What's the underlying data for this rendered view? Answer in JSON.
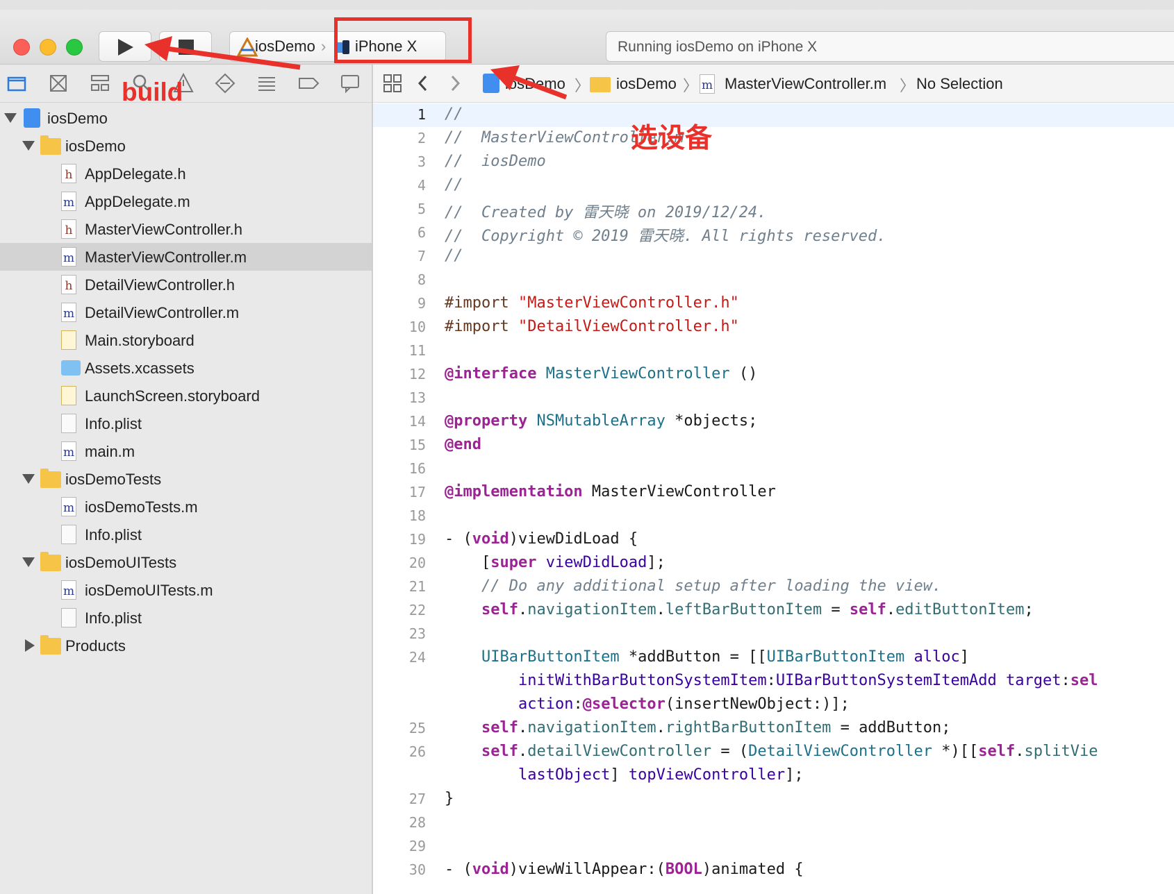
{
  "toolbar": {
    "run_button": "run",
    "stop_button": "stop",
    "scheme": {
      "target": "iosDemo",
      "device": "iPhone X"
    },
    "status_text": "Running iosDemo on iPhone X"
  },
  "annotations": {
    "build": "build",
    "select_device": "选设备",
    "accent_color": "#e8312a"
  },
  "navigator": {
    "tabs": [
      "folder-icon",
      "source-control-icon",
      "hierarchy-icon",
      "search-icon",
      "warning-icon",
      "test-icon",
      "debug-icon",
      "breakpoint-icon",
      "report-icon"
    ],
    "tree": [
      {
        "label": "iosDemo",
        "kind": "project",
        "depth": 0,
        "disclosure": "open"
      },
      {
        "label": "iosDemo",
        "kind": "folder",
        "depth": 1,
        "disclosure": "open"
      },
      {
        "label": "AppDelegate.h",
        "kind": "h",
        "depth": 2
      },
      {
        "label": "AppDelegate.m",
        "kind": "m",
        "depth": 2
      },
      {
        "label": "MasterViewController.h",
        "kind": "h",
        "depth": 2
      },
      {
        "label": "MasterViewController.m",
        "kind": "m",
        "depth": 2,
        "selected": true
      },
      {
        "label": "DetailViewController.h",
        "kind": "h",
        "depth": 2
      },
      {
        "label": "DetailViewController.m",
        "kind": "m",
        "depth": 2
      },
      {
        "label": "Main.storyboard",
        "kind": "storyboard",
        "depth": 2
      },
      {
        "label": "Assets.xcassets",
        "kind": "assets",
        "depth": 2
      },
      {
        "label": "LaunchScreen.storyboard",
        "kind": "storyboard",
        "depth": 2
      },
      {
        "label": "Info.plist",
        "kind": "plist",
        "depth": 2
      },
      {
        "label": "main.m",
        "kind": "m",
        "depth": 2
      },
      {
        "label": "iosDemoTests",
        "kind": "folder",
        "depth": 1,
        "disclosure": "open"
      },
      {
        "label": "iosDemoTests.m",
        "kind": "m",
        "depth": 2
      },
      {
        "label": "Info.plist",
        "kind": "plist",
        "depth": 2
      },
      {
        "label": "iosDemoUITests",
        "kind": "folder",
        "depth": 1,
        "disclosure": "open"
      },
      {
        "label": "iosDemoUITests.m",
        "kind": "m",
        "depth": 2
      },
      {
        "label": "Info.plist",
        "kind": "plist",
        "depth": 2
      },
      {
        "label": "Products",
        "kind": "folder",
        "depth": 1,
        "disclosure": "closed"
      }
    ]
  },
  "jumpbar": {
    "project": "iosDemo",
    "folder": "iosDemo",
    "file": "MasterViewController.m",
    "symbol": "No Selection"
  },
  "code": [
    {
      "n": "1",
      "current": true,
      "tokens": [
        [
          "comment",
          "//"
        ]
      ]
    },
    {
      "n": "2",
      "tokens": [
        [
          "comment",
          "//  MasterViewController.m"
        ]
      ]
    },
    {
      "n": "3",
      "tokens": [
        [
          "comment",
          "//  iosDemo"
        ]
      ]
    },
    {
      "n": "4",
      "tokens": [
        [
          "comment",
          "//"
        ]
      ]
    },
    {
      "n": "5",
      "tokens": [
        [
          "comment",
          "//  Created by 雷天晓 on 2019/12/24."
        ]
      ]
    },
    {
      "n": "6",
      "tokens": [
        [
          "comment",
          "//  Copyright © 2019 雷天晓. All rights reserved."
        ]
      ]
    },
    {
      "n": "7",
      "tokens": [
        [
          "comment",
          "//"
        ]
      ]
    },
    {
      "n": "8",
      "tokens": []
    },
    {
      "n": "9",
      "tokens": [
        [
          "pre",
          "#import "
        ],
        [
          "string",
          "\"MasterViewController.h\""
        ]
      ]
    },
    {
      "n": "10",
      "tokens": [
        [
          "pre",
          "#import "
        ],
        [
          "string",
          "\"DetailViewController.h\""
        ]
      ]
    },
    {
      "n": "11",
      "tokens": []
    },
    {
      "n": "12",
      "tokens": [
        [
          "key",
          "@interface"
        ],
        [
          "plain",
          " "
        ],
        [
          "class",
          "MasterViewController"
        ],
        [
          "plain",
          " ()"
        ]
      ]
    },
    {
      "n": "13",
      "tokens": []
    },
    {
      "n": "14",
      "tokens": [
        [
          "key",
          "@property"
        ],
        [
          "plain",
          " "
        ],
        [
          "class",
          "NSMutableArray"
        ],
        [
          "plain",
          " *objects;"
        ]
      ]
    },
    {
      "n": "15",
      "tokens": [
        [
          "key",
          "@end"
        ]
      ]
    },
    {
      "n": "16",
      "tokens": []
    },
    {
      "n": "17",
      "tokens": [
        [
          "key",
          "@implementation"
        ],
        [
          "plain",
          " MasterViewController"
        ]
      ]
    },
    {
      "n": "18",
      "tokens": []
    },
    {
      "n": "19",
      "tokens": [
        [
          "plain",
          "- ("
        ],
        [
          "key",
          "void"
        ],
        [
          "plain",
          ")viewDidLoad {"
        ]
      ]
    },
    {
      "n": "20",
      "tokens": [
        [
          "plain",
          "    ["
        ],
        [
          "key",
          "super"
        ],
        [
          "plain",
          " "
        ],
        [
          "type",
          "viewDidLoad"
        ],
        [
          "plain",
          "];"
        ]
      ]
    },
    {
      "n": "21",
      "tokens": [
        [
          "comment",
          "    // Do any additional setup after loading the view."
        ]
      ]
    },
    {
      "n": "22",
      "tokens": [
        [
          "plain",
          "    "
        ],
        [
          "key",
          "self"
        ],
        [
          "plain",
          "."
        ],
        [
          "prop",
          "navigationItem"
        ],
        [
          "plain",
          "."
        ],
        [
          "prop",
          "leftBarButtonItem"
        ],
        [
          "plain",
          " = "
        ],
        [
          "key",
          "self"
        ],
        [
          "plain",
          "."
        ],
        [
          "prop",
          "editButtonItem"
        ],
        [
          "plain",
          ";"
        ]
      ]
    },
    {
      "n": "23",
      "tokens": []
    },
    {
      "n": "24",
      "tokens": [
        [
          "plain",
          "    "
        ],
        [
          "class",
          "UIBarButtonItem"
        ],
        [
          "plain",
          " *addButton = [["
        ],
        [
          "class",
          "UIBarButtonItem"
        ],
        [
          "plain",
          " "
        ],
        [
          "type",
          "alloc"
        ],
        [
          "plain",
          "]"
        ]
      ]
    },
    {
      "n": "",
      "tokens": [
        [
          "plain",
          "        "
        ],
        [
          "type",
          "initWithBarButtonSystemItem"
        ],
        [
          "plain",
          ":"
        ],
        [
          "type",
          "UIBarButtonSystemItemAdd"
        ],
        [
          "plain",
          " "
        ],
        [
          "type",
          "target"
        ],
        [
          "plain",
          ":"
        ],
        [
          "key",
          "sel"
        ]
      ]
    },
    {
      "n": "",
      "tokens": [
        [
          "plain",
          "        "
        ],
        [
          "type",
          "action"
        ],
        [
          "plain",
          ":"
        ],
        [
          "key",
          "@selector"
        ],
        [
          "plain",
          "(insertNewObject:)];"
        ]
      ]
    },
    {
      "n": "25",
      "tokens": [
        [
          "plain",
          "    "
        ],
        [
          "key",
          "self"
        ],
        [
          "plain",
          "."
        ],
        [
          "prop",
          "navigationItem"
        ],
        [
          "plain",
          "."
        ],
        [
          "prop",
          "rightBarButtonItem"
        ],
        [
          "plain",
          " = addButton;"
        ]
      ]
    },
    {
      "n": "26",
      "tokens": [
        [
          "plain",
          "    "
        ],
        [
          "key",
          "self"
        ],
        [
          "plain",
          "."
        ],
        [
          "prop",
          "detailViewController"
        ],
        [
          "plain",
          " = ("
        ],
        [
          "class",
          "DetailViewController"
        ],
        [
          "plain",
          " *)[["
        ],
        [
          "key",
          "self"
        ],
        [
          "plain",
          "."
        ],
        [
          "prop",
          "splitVie"
        ]
      ]
    },
    {
      "n": "",
      "tokens": [
        [
          "plain",
          "        "
        ],
        [
          "type",
          "lastObject"
        ],
        [
          "plain",
          "] "
        ],
        [
          "type",
          "topViewController"
        ],
        [
          "plain",
          "];"
        ]
      ]
    },
    {
      "n": "27",
      "tokens": [
        [
          "plain",
          "}"
        ]
      ]
    },
    {
      "n": "28",
      "tokens": []
    },
    {
      "n": "29",
      "tokens": []
    },
    {
      "n": "30",
      "tokens": [
        [
          "plain",
          "- ("
        ],
        [
          "key",
          "void"
        ],
        [
          "plain",
          ")viewWillAppear:("
        ],
        [
          "key",
          "BOOL"
        ],
        [
          "plain",
          ")animated {"
        ]
      ]
    }
  ]
}
